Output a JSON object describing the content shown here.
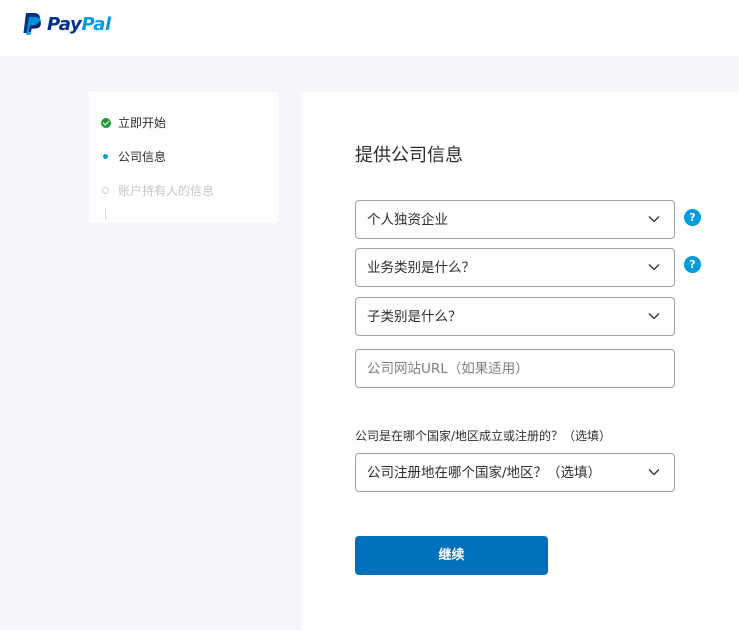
{
  "header": {
    "logo": {
      "icon": "paypal-logo-icon",
      "text_pay": "Pay",
      "text_pal": "Pal"
    }
  },
  "steps": [
    {
      "label": "立即开始",
      "state": "done"
    },
    {
      "label": "公司信息",
      "state": "current"
    },
    {
      "label": "账户持有人的信息",
      "state": "future"
    }
  ],
  "form": {
    "heading": "提供公司信息",
    "business_type": {
      "value": "个人独资企业",
      "icon": "chevron-down-icon",
      "help_icon": "help-icon"
    },
    "category": {
      "value": "业务类别是什么？",
      "icon": "chevron-down-icon",
      "help_icon": "help-icon"
    },
    "subcategory": {
      "value": "子类别是什么？",
      "icon": "chevron-down-icon"
    },
    "website": {
      "placeholder": "公司网站URL（如果适用）"
    },
    "country_label": "公司是在哪个国家/地区成立或注册的？（选填）",
    "country": {
      "value": "公司注册地在哪个国家/地区？（选填）",
      "icon": "chevron-down-icon"
    },
    "continue_label": "继续",
    "help_glyph": "?"
  },
  "colors": {
    "paypal_dark": "#003087",
    "paypal_light": "#009cde",
    "primary_button": "#0070ba",
    "done_green": "#1e9b35"
  }
}
